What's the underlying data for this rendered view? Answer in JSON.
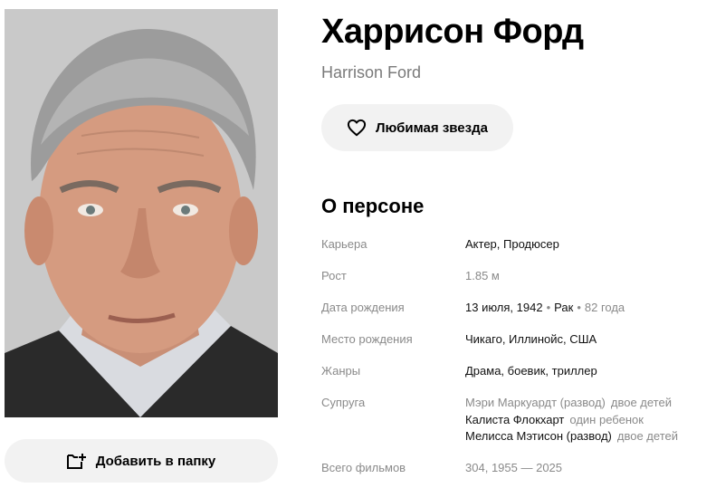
{
  "person": {
    "name_ru": "Харрисон Форд",
    "name_original": "Harrison Ford"
  },
  "actions": {
    "favorite_label": "Любимая звезда",
    "add_folder_label": "Добавить в папку"
  },
  "about": {
    "title": "О персоне",
    "career": {
      "label": "Карьера",
      "value": "Актер, Продюсер"
    },
    "height": {
      "label": "Рост",
      "value": "1.85 м"
    },
    "birth_date": {
      "label": "Дата рождения",
      "date": "13 июля, 1942",
      "sep1": "•",
      "zodiac": "Рак",
      "sep2": "•",
      "age": "82 года"
    },
    "birth_place": {
      "label": "Место рождения",
      "value": "Чикаго, Иллинойс, США"
    },
    "genres": {
      "label": "Жанры",
      "value": "Драма, боевик, триллер"
    },
    "spouses": {
      "label": "Супруга",
      "items": [
        {
          "name": "Мэри Маркуардт (развод)",
          "kids": "двое детей"
        },
        {
          "name": "Калиста Флокхарт",
          "kids": "один ребенок"
        },
        {
          "name": "Мелисса Мэтисон (развод)",
          "kids": "двое детей"
        }
      ]
    },
    "total_films": {
      "label": "Всего фильмов",
      "count": "304",
      "sep": ",",
      "range": "1955 — 2025"
    }
  },
  "icons": {
    "favorite": "heart-outline-icon",
    "add_folder": "folder-plus-icon"
  },
  "colors": {
    "button_bg": "#f2f2f2",
    "muted_text": "#8a8a8a"
  }
}
